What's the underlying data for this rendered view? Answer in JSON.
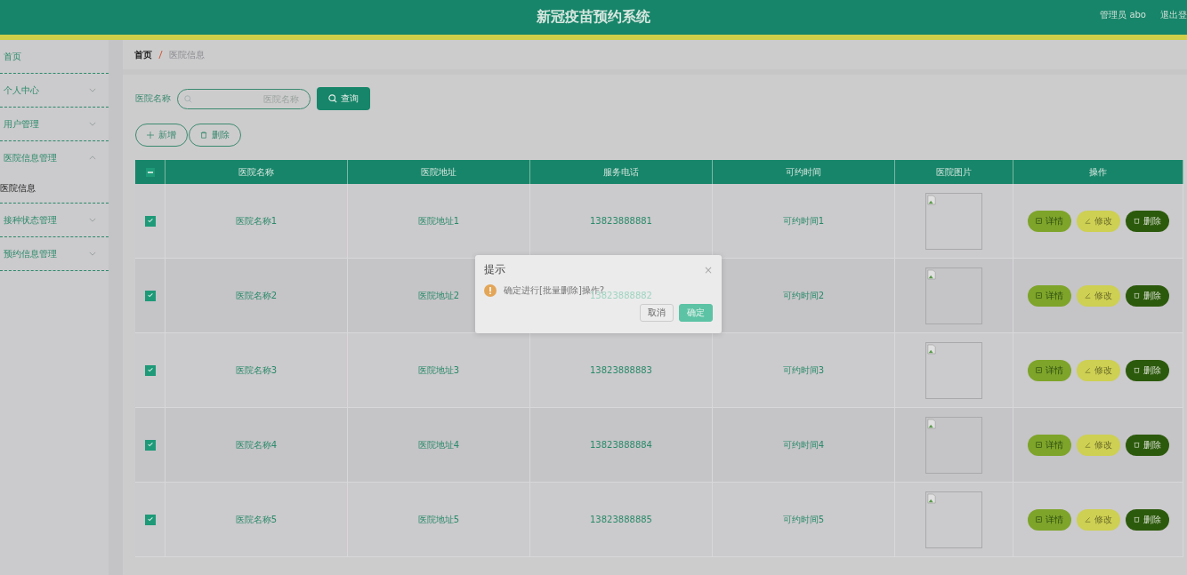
{
  "header": {
    "title": "新冠疫苗预约系统",
    "user": "管理员 abo",
    "logout": "退出登"
  },
  "sidebar": {
    "items": [
      {
        "label": "首页",
        "kind": "link"
      },
      {
        "label": "个人中心",
        "kind": "menu",
        "expanded": false
      },
      {
        "label": "用户管理",
        "kind": "menu",
        "expanded": false
      },
      {
        "label": "医院信息管理",
        "kind": "menu",
        "expanded": true,
        "children": [
          {
            "label": "医院信息",
            "selected": true
          }
        ]
      },
      {
        "label": "接种状态管理",
        "kind": "menu",
        "expanded": false
      },
      {
        "label": "预约信息管理",
        "kind": "menu",
        "expanded": false
      }
    ]
  },
  "breadcrumb": [
    "首页",
    "医院信息"
  ],
  "search": {
    "label": "医院名称",
    "placeholder": "医院名称",
    "button": "查询"
  },
  "actions": [
    {
      "label": "新增",
      "kind": "add"
    },
    {
      "label": "删除",
      "kind": "delete"
    }
  ],
  "table": {
    "header_indeterminate": true,
    "columns": [
      "医院名称",
      "医院地址",
      "服务电话",
      "可约时间",
      "医院图片",
      "操作"
    ],
    "rows": [
      {
        "checked": true,
        "cells": [
          "医院名称1",
          "医院地址1",
          "13823888881",
          "可约时间1"
        ],
        "actions": [
          {
            "label": "详情",
            "kind": "detail"
          },
          {
            "label": "修改",
            "kind": "edit"
          },
          {
            "label": "删除",
            "kind": "delete"
          }
        ]
      },
      {
        "checked": true,
        "cells": [
          "医院名称2",
          "医院地址2",
          "13823888882",
          "可约时间2"
        ],
        "actions": [
          {
            "label": "详情",
            "kind": "detail"
          },
          {
            "label": "修改",
            "kind": "edit"
          },
          {
            "label": "删除",
            "kind": "delete"
          }
        ]
      },
      {
        "checked": true,
        "cells": [
          "医院名称3",
          "医院地址3",
          "13823888883",
          "可约时间3"
        ],
        "actions": [
          {
            "label": "详情",
            "kind": "detail"
          },
          {
            "label": "修改",
            "kind": "edit"
          },
          {
            "label": "删除",
            "kind": "delete"
          }
        ]
      },
      {
        "checked": true,
        "cells": [
          "医院名称4",
          "医院地址4",
          "13823888884",
          "可约时间4"
        ],
        "actions": [
          {
            "label": "详情",
            "kind": "detail"
          },
          {
            "label": "修改",
            "kind": "edit"
          },
          {
            "label": "删除",
            "kind": "delete"
          }
        ]
      },
      {
        "checked": true,
        "cells": [
          "医院名称5",
          "医院地址5",
          "13823888885",
          "可约时间5"
        ],
        "actions": [
          {
            "label": "详情",
            "kind": "detail"
          },
          {
            "label": "修改",
            "kind": "edit"
          },
          {
            "label": "删除",
            "kind": "delete"
          }
        ]
      }
    ]
  },
  "dialog": {
    "title": "提示",
    "close": "×",
    "message": "确定进行[批量删除]操作?",
    "buttons": [
      {
        "label": "取消",
        "kind": "cancel"
      },
      {
        "label": "确定",
        "kind": "confirm"
      }
    ]
  }
}
